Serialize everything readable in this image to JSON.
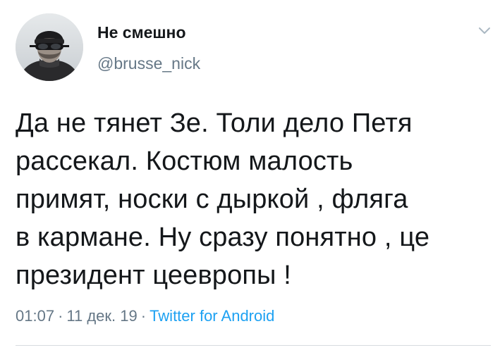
{
  "author": {
    "display_name": "Не смешно",
    "handle": "@brusse_nick"
  },
  "tweet": {
    "text": "Да не тянет Зе. Толи дело Петя\nрассекал. Костюм малость\nпримят, носки с дыркой , фляга\nв кармане. Ну сразу понятно , це\nпрезидент цеевропы !",
    "time": "01:07",
    "date": "11 дек. 19",
    "separator": "·",
    "source": "Twitter for Android"
  },
  "icons": {
    "menu": "chevron-down-icon",
    "avatar": "profile-photo"
  },
  "colors": {
    "text": "#14171a",
    "secondary": "#657786",
    "link": "#1da1f2",
    "divider": "#d6dbdf"
  }
}
